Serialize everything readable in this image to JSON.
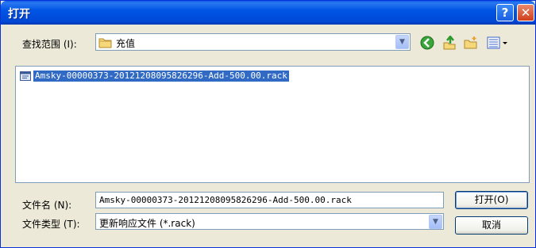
{
  "window": {
    "title": "打开",
    "help_label": "?",
    "close_label": "✕"
  },
  "lookin": {
    "label": "查找范围 (I):",
    "value": "充值"
  },
  "toolbar": {
    "back_icon": "back-arrow-icon",
    "up_icon": "up-folder-icon",
    "new_folder_icon": "new-folder-icon",
    "views_icon": "views-menu-icon"
  },
  "files": [
    {
      "name": "Amsky-00000373-20121208095826296-Add-500.00.rack",
      "selected": true
    }
  ],
  "filename": {
    "label": "文件名 (N):",
    "value": "Amsky-00000373-20121208095826296-Add-500.00.rack"
  },
  "filetype": {
    "label": "文件类型 (T):",
    "value": "更新响应文件 (*.rack)"
  },
  "buttons": {
    "open": "打开(O)",
    "cancel": "取消"
  },
  "colors": {
    "titlebar": "#0055e5",
    "selection": "#316ac5",
    "dialog_bg": "#ece9d8"
  }
}
